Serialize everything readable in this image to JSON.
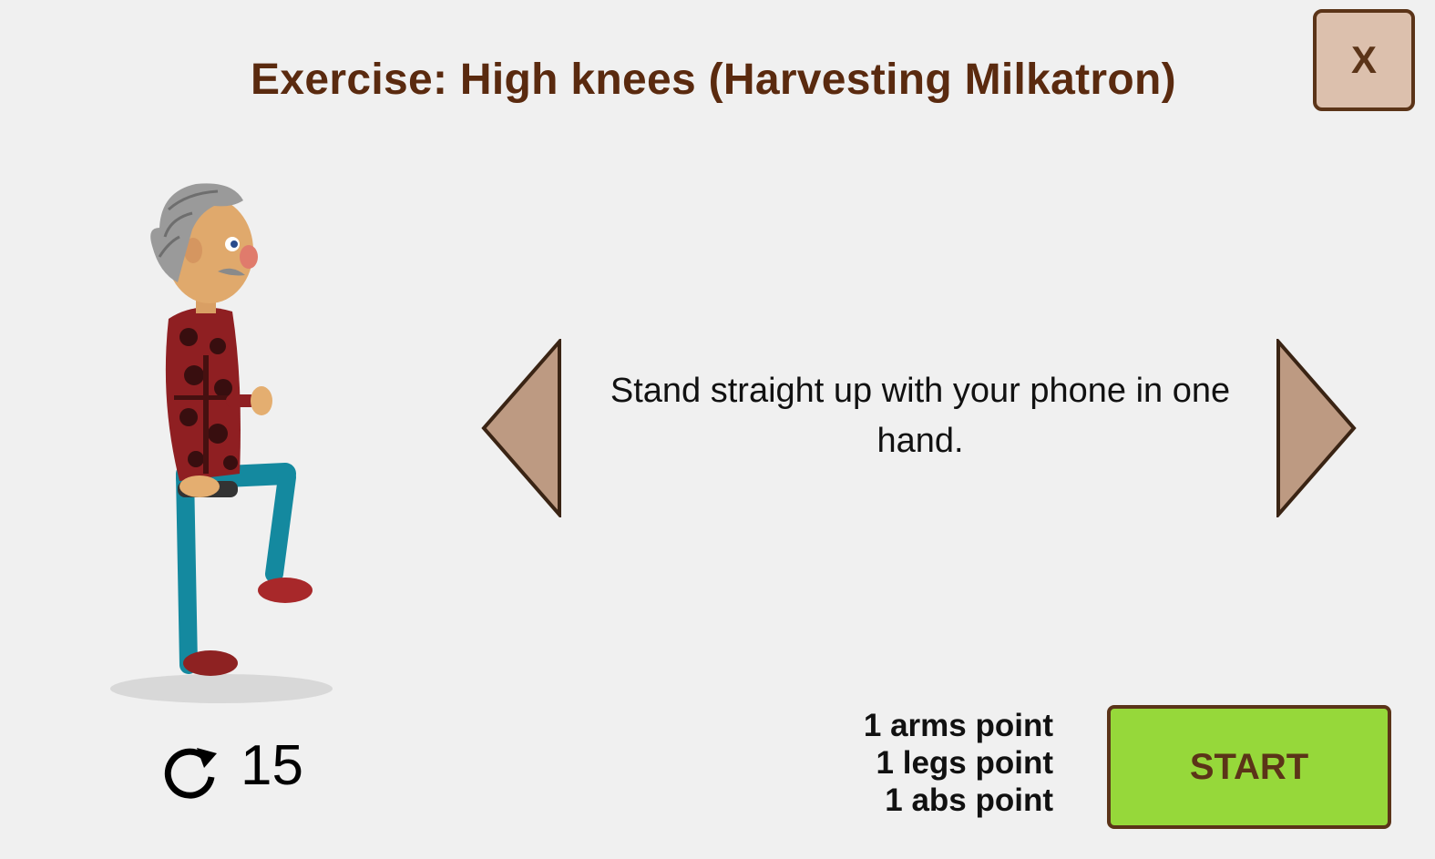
{
  "dialog": {
    "title": "Exercise: High knees (Harvesting Milkatron)",
    "close_label": "X"
  },
  "exercise": {
    "instruction": "Stand straight up with your phone in one hand.",
    "repetitions": "15",
    "repeat_icon": "repeat-icon",
    "prev_icon": "triangle-left-icon",
    "next_icon": "triangle-right-icon"
  },
  "points": [
    "1 arms point",
    "1 legs point",
    "1 abs point"
  ],
  "start_label": "START",
  "colors": {
    "background": "#f0f0f0",
    "title": "#5a2a0f",
    "button_border": "#5b3418",
    "close_fill": "#dcc0ad",
    "arrow_fill": "#bd9a82",
    "start_fill": "#96d83a"
  }
}
